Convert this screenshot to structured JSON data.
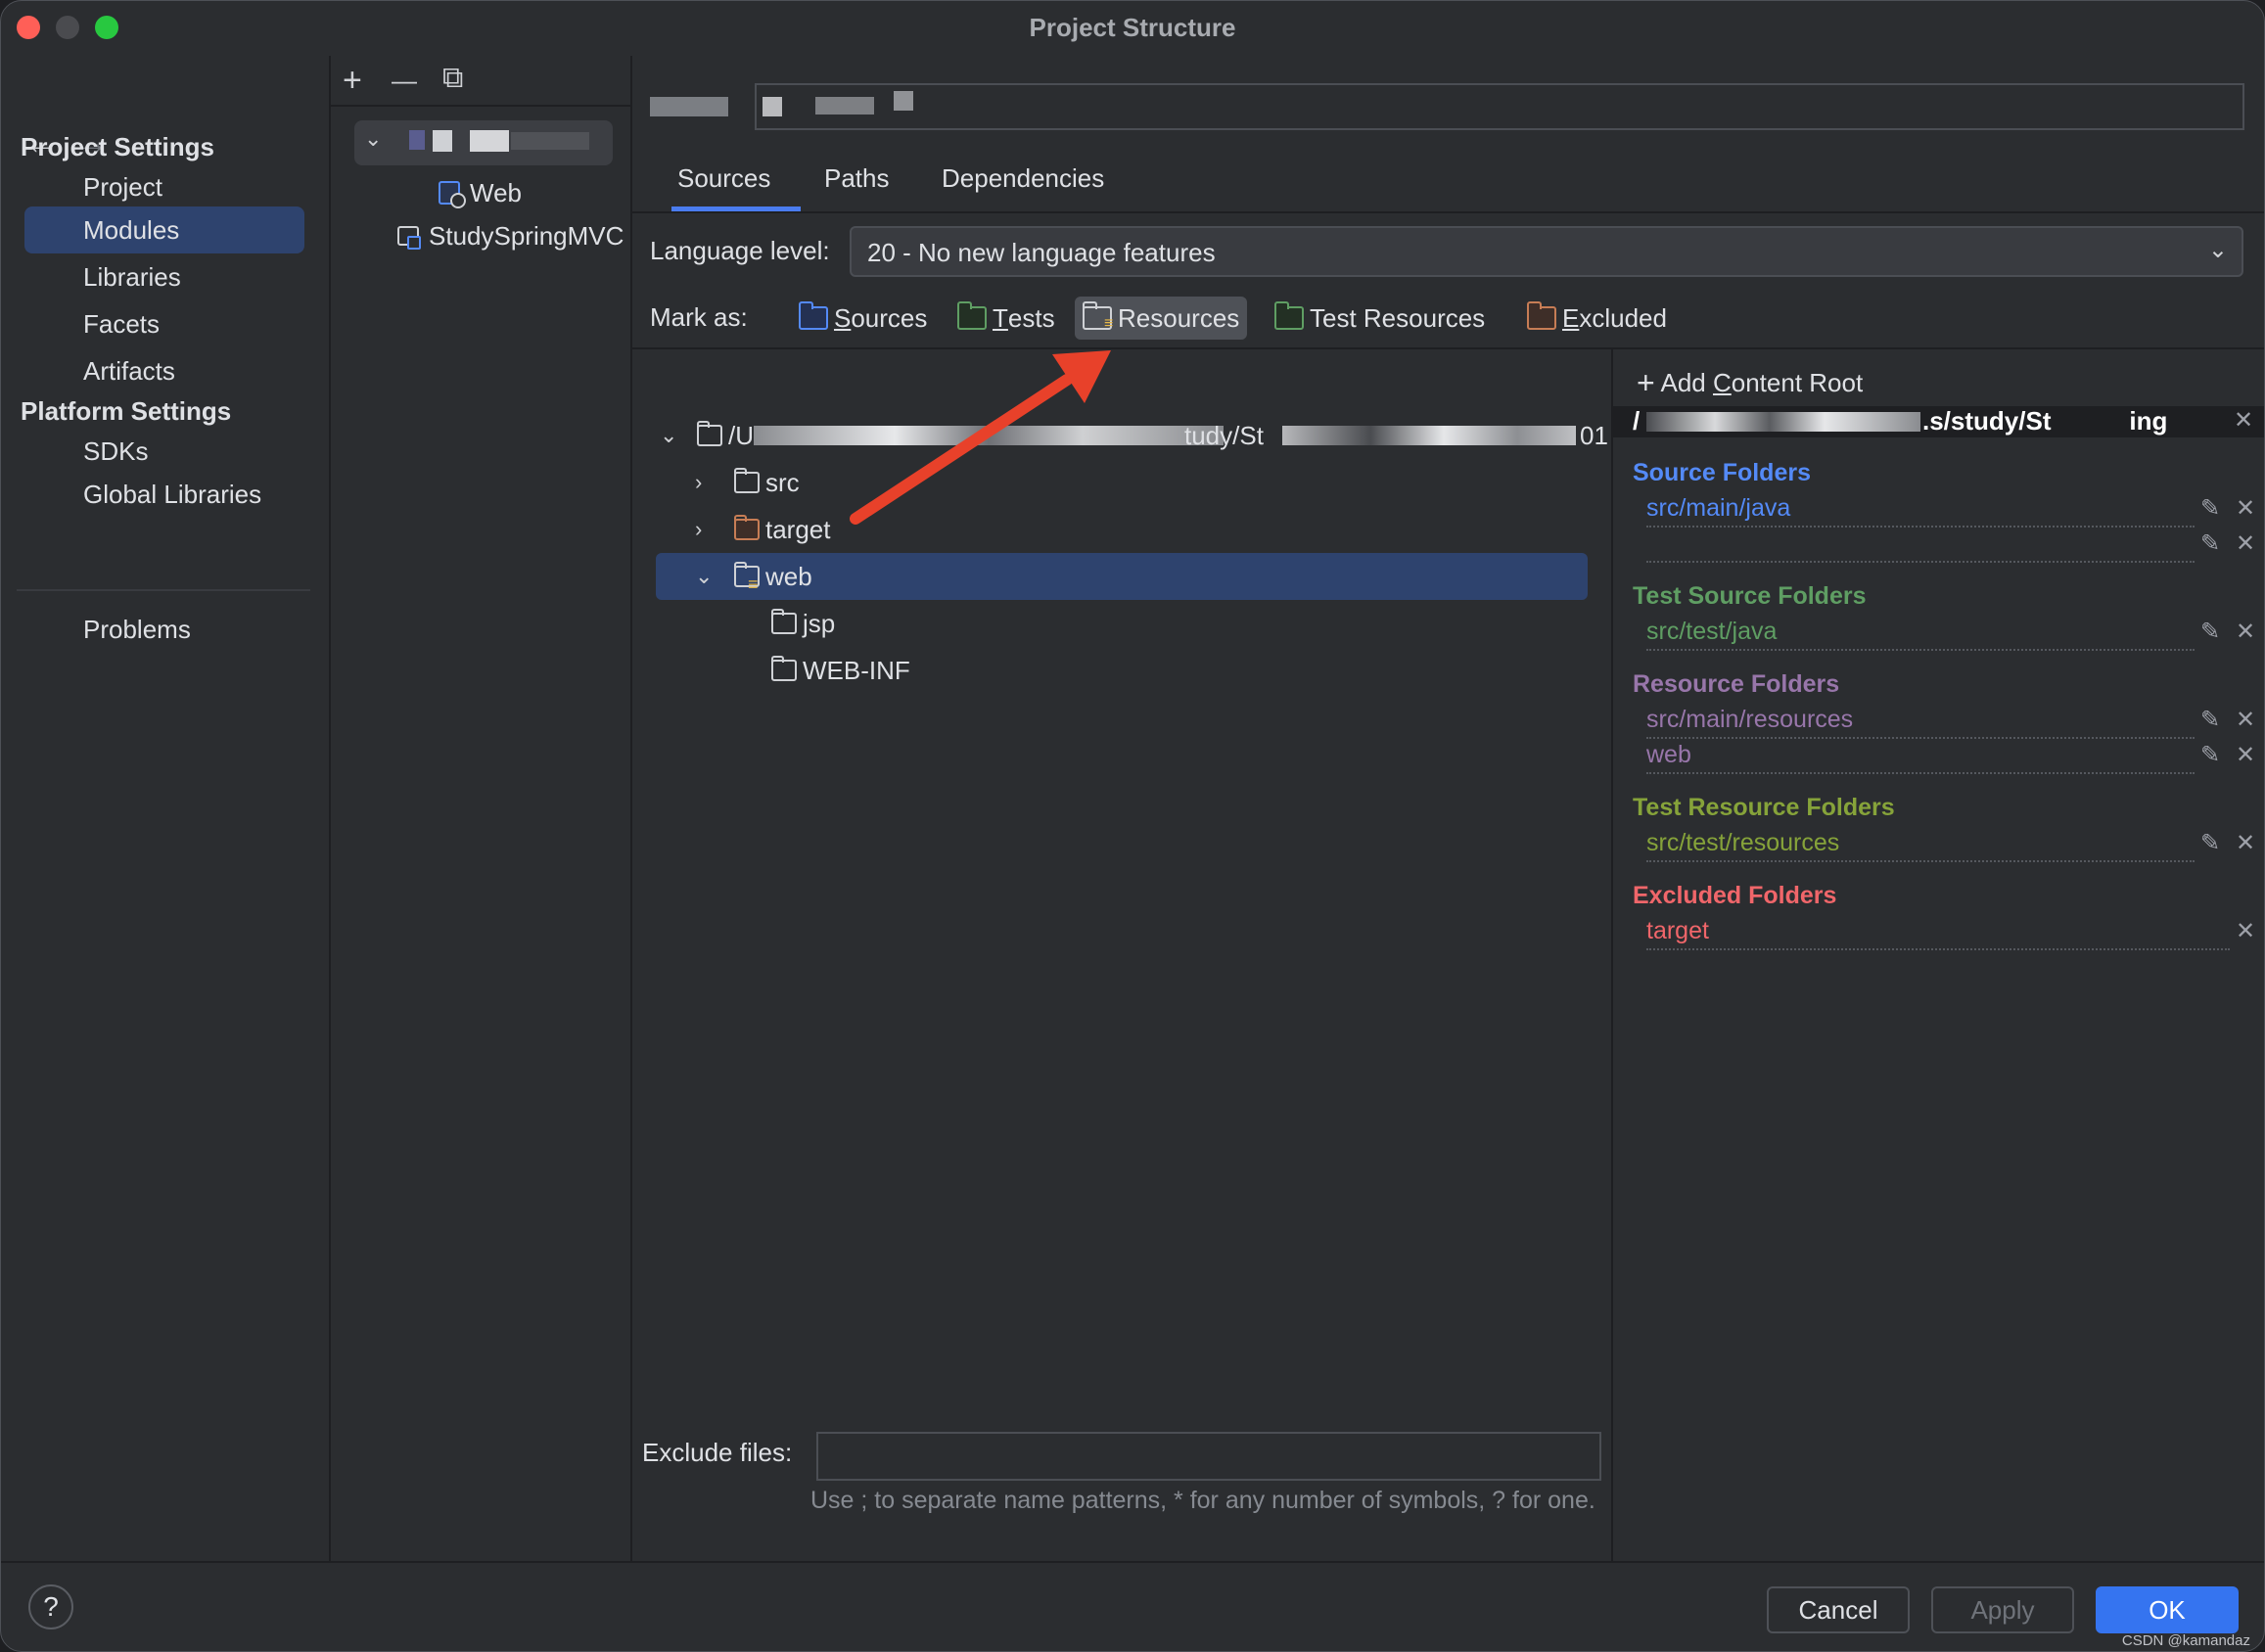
{
  "window": {
    "title": "Project Structure",
    "traffic_lights": {
      "close": "#ff5f57",
      "minimize": "#4a4b4f",
      "zoom": "#28c840"
    }
  },
  "sidebar": {
    "back_icon": "←",
    "forward_icon": "→",
    "project_settings_header": "Project Settings",
    "project_items": [
      {
        "label": "Project",
        "selected": false
      },
      {
        "label": "Modules",
        "selected": true
      },
      {
        "label": "Libraries",
        "selected": false
      },
      {
        "label": "Facets",
        "selected": false
      },
      {
        "label": "Artifacts",
        "selected": false
      }
    ],
    "platform_settings_header": "Platform Settings",
    "platform_items": [
      {
        "label": "SDKs"
      },
      {
        "label": "Global Libraries"
      }
    ],
    "problems_label": "Problems"
  },
  "modules": {
    "toolbar": {
      "add": "+",
      "remove": "—",
      "copy": "⧉"
    },
    "tree": [
      {
        "label": "",
        "obscured": true,
        "expanded": true
      },
      {
        "label": "Web",
        "icon": "web-facet-icon"
      },
      {
        "label": "StudySpringMVC",
        "icon": "module-folder-icon"
      }
    ]
  },
  "main": {
    "name_field": {
      "obscured": true
    },
    "tabs": [
      {
        "label": "Sources",
        "active": true
      },
      {
        "label": "Paths",
        "active": false
      },
      {
        "label": "Dependencies",
        "active": false
      }
    ],
    "language_level": {
      "label": "Language level:",
      "value": "20 - No new language features",
      "chevron": "⌄"
    },
    "mark_as": {
      "label": "Mark as:",
      "buttons": [
        {
          "label": "Sources",
          "mnemonic": "S",
          "rest": "ources",
          "color": "#548af7",
          "active": false
        },
        {
          "label": "Tests",
          "mnemonic": "T",
          "rest": "ests",
          "color": "#5f9e63",
          "active": false
        },
        {
          "label": "Resources",
          "mnemonic": "",
          "rest": "Resources",
          "color": "#cfd1d5",
          "active": true
        },
        {
          "label": "Test Resources",
          "mnemonic": "",
          "rest": "Test Resources",
          "color": "#5f9e63",
          "active": false
        },
        {
          "label": "Excluded",
          "mnemonic": "E",
          "rest": "xcluded",
          "color": "#c77d55",
          "active": false
        }
      ]
    },
    "tree": {
      "root": {
        "label": "/U…/study/StudySpringMVC/…01",
        "obscured": true,
        "expanded": true
      },
      "items": [
        {
          "label": "src",
          "expanded": false,
          "color": "#cfd1d5"
        },
        {
          "label": "target",
          "expanded": false,
          "color": "#c77d55"
        },
        {
          "label": "web",
          "expanded": true,
          "selected": true,
          "color": "#cfd1d5",
          "resource": true
        },
        {
          "label": "jsp",
          "color": "#cfd1d5"
        },
        {
          "label": "WEB-INF",
          "color": "#cfd1d5"
        }
      ]
    },
    "content_root": {
      "add_label_pre": "Add ",
      "add_mnemonic": "C",
      "add_label_post": "ontent Root",
      "path": "/…/study/St…ing",
      "path_obscured": true,
      "sections": [
        {
          "title": "Source Folders",
          "color": "#548af7",
          "items": [
            "src/main/java",
            ""
          ]
        },
        {
          "title": "Test Source Folders",
          "color": "#5f9e63",
          "items": [
            "src/test/java"
          ]
        },
        {
          "title": "Resource Folders",
          "color": "#9876aa",
          "items": [
            "src/main/resources",
            "web"
          ]
        },
        {
          "title": "Test Resource Folders",
          "color": "#86a33a",
          "items": [
            "src/test/resources"
          ]
        },
        {
          "title": "Excluded Folders",
          "color": "#f0666a",
          "items": [
            "target"
          ]
        }
      ]
    },
    "exclude_files": {
      "label": "Exclude files:",
      "value": "",
      "hint": "Use ; to separate name patterns, * for any number of symbols, ? for one."
    }
  },
  "footer": {
    "help": "?",
    "cancel": "Cancel",
    "apply": "Apply",
    "ok": "OK",
    "watermark": "CSDN @kamandaz"
  },
  "annotation": {
    "type": "red-arrow",
    "color": "#e8412a",
    "points_to": "Resources"
  }
}
